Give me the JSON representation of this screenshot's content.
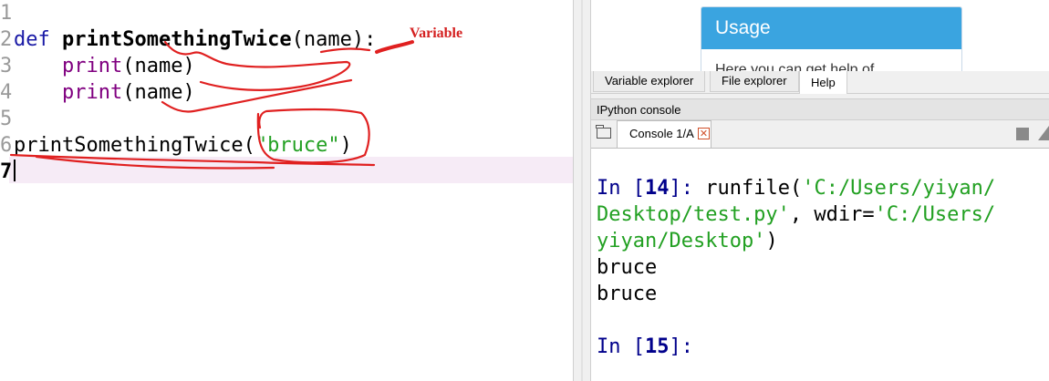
{
  "editor": {
    "line_numbers": [
      "1",
      "2",
      "3",
      "4",
      "5",
      "6",
      "7"
    ],
    "line2": {
      "kw": "def",
      "fn": "printSomethingTwice",
      "open": "(",
      "param": "name",
      "close": "):"
    },
    "line3": {
      "builtin": "print",
      "args": "(name)"
    },
    "line4": {
      "builtin": "print",
      "args": "(name)"
    },
    "line6": {
      "call": "printSomethingTwice",
      "open": "(",
      "str": "\"bruce\"",
      "close": ")"
    },
    "annotation": {
      "text": "Variable",
      "color": "#d42020"
    }
  },
  "help_pane": {
    "card_title": "Usage",
    "card_body_partial": "Here you can get help of"
  },
  "tabs": [
    {
      "label": "Variable explorer",
      "active": false
    },
    {
      "label": "File explorer",
      "active": false
    },
    {
      "label": "Help",
      "active": true
    }
  ],
  "ipython": {
    "title": "IPython console",
    "console_tab": "Console 1/A",
    "lines": {
      "in14_prefix": "In [",
      "in14_num": "14",
      "in14_suffix": "]: ",
      "cmd1": "runfile(",
      "path1": "'C:/Users/yiyan/",
      "path2": "Desktop/test.py'",
      "mid": ", wdir=",
      "path3": "'C:/Users/",
      "path4": "yiyan/Desktop'",
      "end": ")",
      "out1": "bruce",
      "out2": "bruce",
      "in15_prefix": "In [",
      "in15_num": "15",
      "in15_suffix": "]:"
    }
  },
  "colors": {
    "keyword": "#1a1aa6",
    "builtin": "#800080",
    "string": "#22a022",
    "prompt": "#00008b",
    "usage_header": "#3aa4e0",
    "current_line": "#f6ebf6"
  }
}
